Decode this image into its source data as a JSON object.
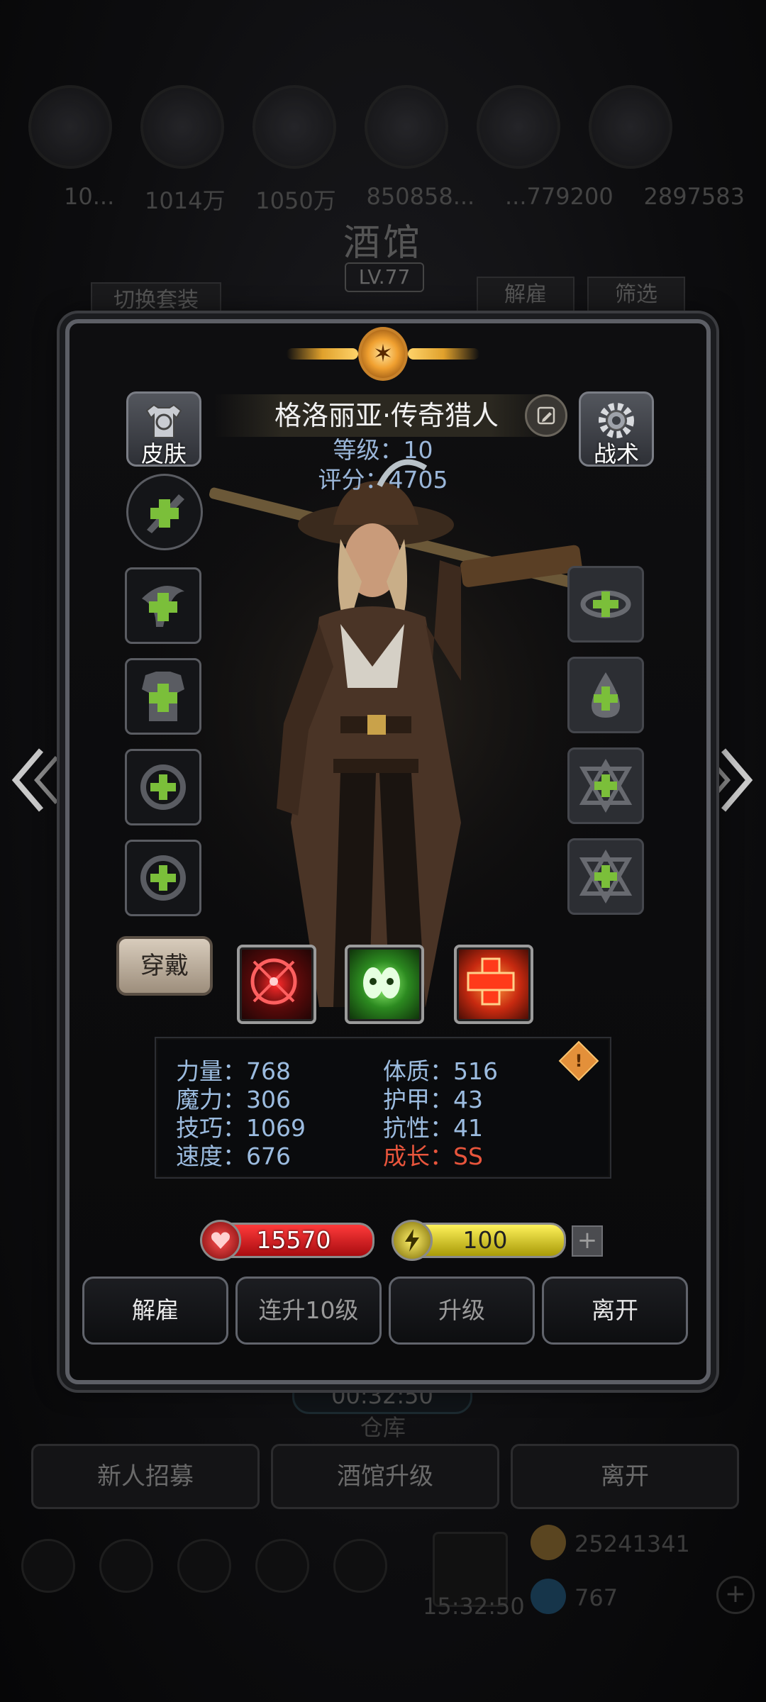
{
  "background": {
    "stats": [
      "10...",
      "1014万",
      "1050万",
      "850858...",
      "...779200",
      "2897583"
    ],
    "title": "酒馆",
    "level": "LV.77",
    "switch_outfit": "切换套装",
    "dismiss_tab": "解雇",
    "filter_tab": "筛选",
    "timer": "00:32:50",
    "warehouse": "仓库",
    "buttons": [
      "新人招募",
      "酒馆升级",
      "离开"
    ],
    "gift_timer": "15:32:50",
    "gold": "25241341",
    "gems": "767"
  },
  "hero": {
    "name": "格洛丽亚·传奇猎人",
    "level": "等级：10",
    "score": "评分：4705"
  },
  "side": {
    "skin": "皮肤",
    "tactics": "战术"
  },
  "wear_button": "穿戴",
  "skills": [
    "crosshair-skill-icon",
    "poison-skull-skill-icon",
    "heal-cross-skill-icon"
  ],
  "stats": {
    "strength": "力量：768",
    "constitution": "体质：516",
    "magic": "魔力：306",
    "armor": "护甲：43",
    "skill": "技巧：1069",
    "resistance": "抗性：41",
    "speed": "速度：676",
    "growth": "成长：SS"
  },
  "resources": {
    "hp": "15570",
    "energy": "100"
  },
  "actions": {
    "dismiss": "解雇",
    "level10": "连升10级",
    "upgrade": "升级",
    "leave": "离开"
  },
  "colors": {
    "stat_text": "#9cbce0",
    "growth_text": "#e8553c",
    "hp_bar": "#c8141a",
    "energy_bar": "#e0d21a",
    "panel_border": "#5d5f66"
  }
}
